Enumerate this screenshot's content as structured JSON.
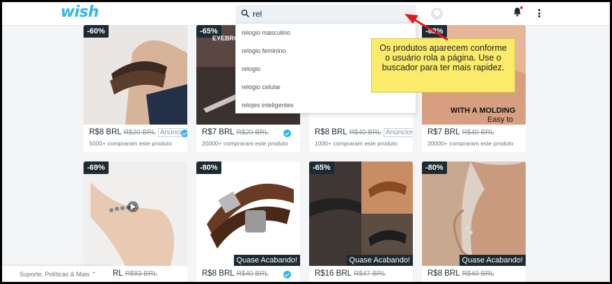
{
  "header": {
    "logo_text": "wish",
    "search": {
      "value": "rel",
      "placeholder": ""
    }
  },
  "search_suggestions": [
    "relogio masculino",
    "relogio feminino",
    "relogio",
    "relogio celular",
    "relojes inteligentes"
  ],
  "products": [
    {
      "discount": "-60%",
      "price": "R$8 BRL",
      "original": "R$20 BRL",
      "ad_label": "Anúncios",
      "sold": "5000+ compraram este produto",
      "verified": true
    },
    {
      "discount": "-65%",
      "image_text": "EYEBRO",
      "price": "R$7 BRL",
      "original": "R$20 BRL",
      "sold": "20000+ compraram este produto",
      "verified": true
    },
    {
      "discount": "",
      "price": "R$8 BRL",
      "original": "R$40 BRL",
      "ad_label": "Anúncios",
      "sold": "1000+ compraram este produto",
      "verified": false
    },
    {
      "discount": "-82%",
      "image_text_1": "WITH A MOLDING",
      "image_text_2": "Easy to use",
      "price": "R$7 BRL",
      "original": "R$40 BRL",
      "sold": "20000+ compraram este produto",
      "verified": false
    },
    {
      "discount": "-69%",
      "price": "RL",
      "original": "R$83 BRL",
      "urgency": "",
      "verified": false
    },
    {
      "discount": "-80%",
      "price": "R$8 BRL",
      "original": "R$40 BRL",
      "urgency": "Quase Acabando!",
      "verified": true
    },
    {
      "discount": "-65%",
      "price": "R$16 BRL",
      "original": "R$47 BRL",
      "urgency": "Quase Acabando!",
      "verified": false
    },
    {
      "discount": "-80%",
      "price": "R$8 BRL",
      "original": "R$40 BRL",
      "urgency": "Quase Acabando!",
      "verified": false
    }
  ],
  "annotation": {
    "text": "Os produtos aparecem conforme o usuário rola a página. Use o buscador para ter mais rapidez.",
    "color": "#fbeb6b",
    "arrow_color": "#e01b1b"
  },
  "footer": {
    "label": "Suporte, Políticas & Mais"
  },
  "colors": {
    "brand": "#2fb7ec",
    "badge": "#1b2a33",
    "notification": "#e8334a"
  }
}
